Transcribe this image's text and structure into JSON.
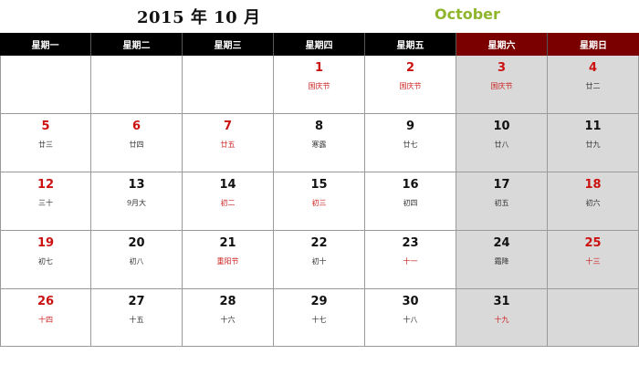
{
  "header": {
    "title_cn": "2015 年 10 月",
    "title_en": "October"
  },
  "weekdays": [
    {
      "label": "星期一",
      "weekend": false
    },
    {
      "label": "星期二",
      "weekend": false
    },
    {
      "label": "星期三",
      "weekend": false
    },
    {
      "label": "星期四",
      "weekend": false
    },
    {
      "label": "星期五",
      "weekend": false
    },
    {
      "label": "星期六",
      "weekend": true
    },
    {
      "label": "星期日",
      "weekend": true
    }
  ],
  "weeks": [
    [
      null,
      null,
      null,
      {
        "day": "1",
        "lunar": "国庆节",
        "day_red": true,
        "lunar_red": true
      },
      {
        "day": "2",
        "lunar": "国庆节",
        "day_red": true,
        "lunar_red": true
      },
      {
        "day": "3",
        "lunar": "国庆节",
        "day_red": true,
        "lunar_red": true
      },
      {
        "day": "4",
        "lunar": "廿二",
        "day_red": true,
        "lunar_red": false
      }
    ],
    [
      {
        "day": "5",
        "lunar": "廿三",
        "day_red": true,
        "lunar_red": false
      },
      {
        "day": "6",
        "lunar": "廿四",
        "day_red": true,
        "lunar_red": false
      },
      {
        "day": "7",
        "lunar": "廿五",
        "day_red": true,
        "lunar_red": true
      },
      {
        "day": "8",
        "lunar": "寒露",
        "day_red": false,
        "lunar_red": false
      },
      {
        "day": "9",
        "lunar": "廿七",
        "day_red": false,
        "lunar_red": false
      },
      {
        "day": "10",
        "lunar": "廿八",
        "day_red": false,
        "lunar_red": false
      },
      {
        "day": "11",
        "lunar": "廿九",
        "day_red": false,
        "lunar_red": false
      }
    ],
    [
      {
        "day": "12",
        "lunar": "三十",
        "day_red": true,
        "lunar_red": false
      },
      {
        "day": "13",
        "lunar": "9月大",
        "day_red": false,
        "lunar_red": false
      },
      {
        "day": "14",
        "lunar": "初二",
        "day_red": false,
        "lunar_red": true
      },
      {
        "day": "15",
        "lunar": "初三",
        "day_red": false,
        "lunar_red": true
      },
      {
        "day": "16",
        "lunar": "初四",
        "day_red": false,
        "lunar_red": false
      },
      {
        "day": "17",
        "lunar": "初五",
        "day_red": false,
        "lunar_red": false
      },
      {
        "day": "18",
        "lunar": "初六",
        "day_red": true,
        "lunar_red": false
      }
    ],
    [
      {
        "day": "19",
        "lunar": "初七",
        "day_red": true,
        "lunar_red": false
      },
      {
        "day": "20",
        "lunar": "初八",
        "day_red": false,
        "lunar_red": false
      },
      {
        "day": "21",
        "lunar": "重阳节",
        "day_red": false,
        "lunar_red": true
      },
      {
        "day": "22",
        "lunar": "初十",
        "day_red": false,
        "lunar_red": false
      },
      {
        "day": "23",
        "lunar": "十一",
        "day_red": false,
        "lunar_red": true
      },
      {
        "day": "24",
        "lunar": "霜降",
        "day_red": false,
        "lunar_red": false
      },
      {
        "day": "25",
        "lunar": "十三",
        "day_red": true,
        "lunar_red": true
      }
    ],
    [
      {
        "day": "26",
        "lunar": "十四",
        "day_red": true,
        "lunar_red": true
      },
      {
        "day": "27",
        "lunar": "十五",
        "day_red": false,
        "lunar_red": false
      },
      {
        "day": "28",
        "lunar": "十六",
        "day_red": false,
        "lunar_red": false
      },
      {
        "day": "29",
        "lunar": "十七",
        "day_red": false,
        "lunar_red": false
      },
      {
        "day": "30",
        "lunar": "十八",
        "day_red": false,
        "lunar_red": false
      },
      {
        "day": "31",
        "lunar": "十九",
        "day_red": false,
        "lunar_red": true
      },
      null
    ]
  ],
  "colors": {
    "header_bg": "#000000",
    "weekend_header_bg": "#7a0000",
    "weekend_cell_bg": "#d9d9d9",
    "holiday_red": "#cc1111",
    "month_en_green": "#8fb52c"
  }
}
